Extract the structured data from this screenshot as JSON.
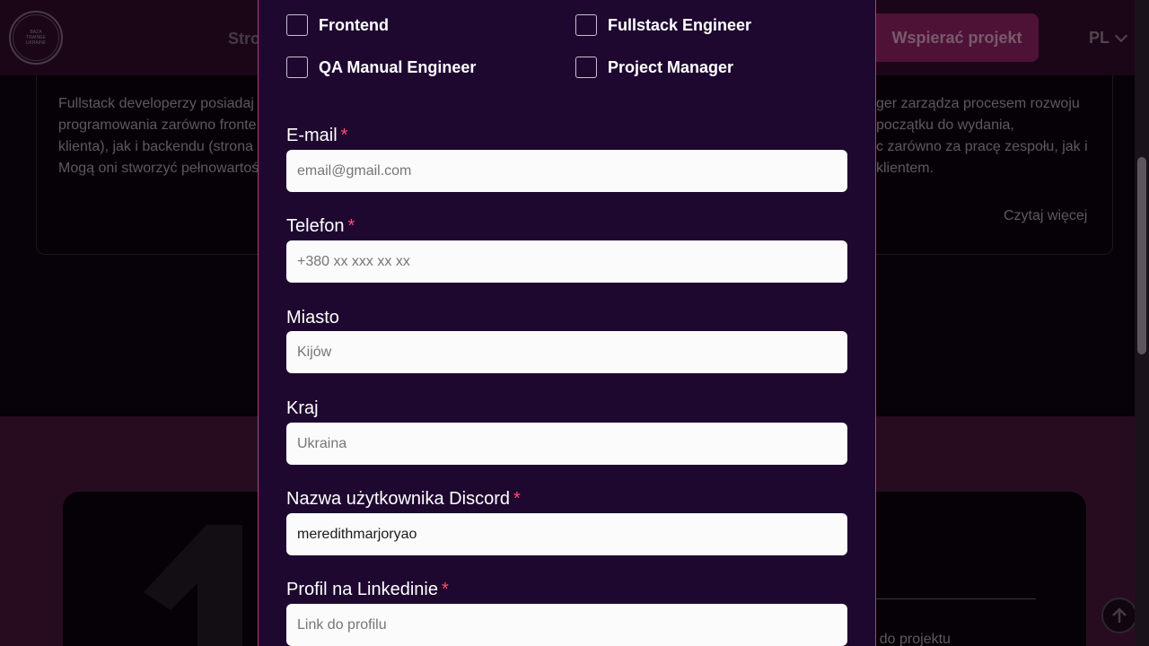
{
  "header": {
    "logo_text": "BAZA TRAINEE UKRAINE",
    "nav_fragment": "Stro",
    "support_button": "Wspierać projekt",
    "language": "PL"
  },
  "background_card": {
    "left_lines": [
      "Fullstack developerzy posiadaj",
      "programowania zarówno fronte",
      "klienta), jak i backendu (strona",
      "Mogą oni stworzyć pełnowartoś"
    ],
    "right_lines": [
      "ger zarządza procesem rozwoju",
      "początku do wydania,",
      "c zarówno za pracę zespołu, jak i",
      "klientem."
    ],
    "read_more": "Czytaj więcej"
  },
  "background_lower": {
    "join_text": "r do projektu"
  },
  "modal": {
    "roles": [
      {
        "label": "Frontend",
        "checked": false
      },
      {
        "label": "Fullstack Engineer",
        "checked": false
      },
      {
        "label": "QA Manual Engineer",
        "checked": false
      },
      {
        "label": "Project Manager",
        "checked": false
      }
    ],
    "email": {
      "label": "E-mail",
      "required_mark": "*",
      "placeholder": "email@gmail.com",
      "value": ""
    },
    "phone": {
      "label": "Telefon",
      "required_mark": "*",
      "placeholder": "+380 xx xxx xx xx",
      "value": ""
    },
    "city": {
      "label": "Miasto",
      "placeholder": "Kijów",
      "value": ""
    },
    "country": {
      "label": "Kraj",
      "placeholder": "Ukraina",
      "value": ""
    },
    "discord": {
      "label": "Nazwa użytkownika Discord",
      "required_mark": "*",
      "placeholder": "",
      "value": "meredithmarjoryao"
    },
    "linkedin": {
      "label": "Profil na Linkedinie",
      "required_mark": "*",
      "placeholder": "Link do profilu",
      "value": ""
    }
  },
  "colors": {
    "modal_bg": "#1e0830",
    "accent_border": "#b0407a",
    "required": "#ff4d6d",
    "support_button": "#7a1d55"
  }
}
